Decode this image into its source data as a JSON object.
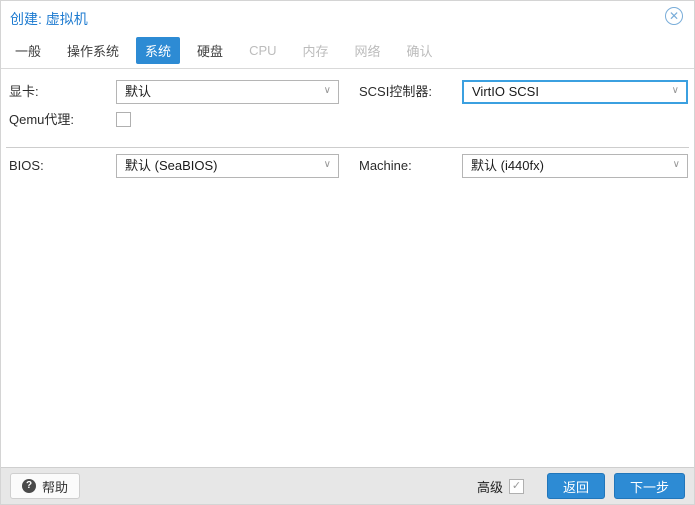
{
  "window": {
    "title": "创建: 虚拟机"
  },
  "tabs": [
    {
      "label": "一般",
      "state": "enabled"
    },
    {
      "label": "操作系统",
      "state": "enabled"
    },
    {
      "label": "系统",
      "state": "active"
    },
    {
      "label": "硬盘",
      "state": "enabled"
    },
    {
      "label": "CPU",
      "state": "disabled"
    },
    {
      "label": "内存",
      "state": "disabled"
    },
    {
      "label": "网络",
      "state": "disabled"
    },
    {
      "label": "确认",
      "state": "disabled"
    }
  ],
  "form": {
    "graphics": {
      "label": "显卡:",
      "value": "默认"
    },
    "scsi_controller": {
      "label": "SCSI控制器:",
      "value": "VirtIO SCSI",
      "focused": true
    },
    "qemu_agent": {
      "label": "Qemu代理:",
      "checked": false
    },
    "bios": {
      "label": "BIOS:",
      "value": "默认 (SeaBIOS)"
    },
    "machine": {
      "label": "Machine:",
      "value": "默认 (i440fx)"
    }
  },
  "footer": {
    "help_label": "帮助",
    "advanced_label": "高级",
    "advanced_checked": true,
    "back_label": "返回",
    "next_label": "下一步"
  },
  "icons": {
    "close": "✕",
    "help": "?",
    "check": "✓",
    "chevron_down": "∨"
  },
  "colors": {
    "accent": "#2d8bd4",
    "focus_border": "#3ba0e0",
    "title_text": "#1e7bd0",
    "footer_bg": "#e7e7e7"
  }
}
